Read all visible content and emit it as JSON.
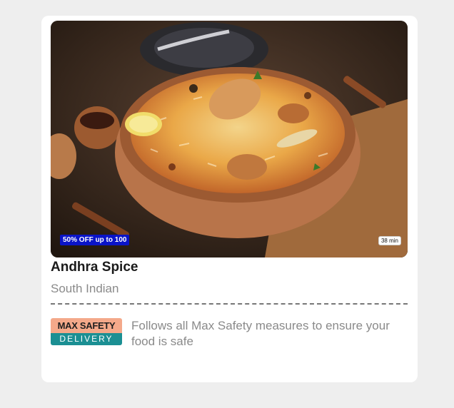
{
  "restaurant": {
    "name": "Andhra Spice",
    "cuisine": "South Indian",
    "offer": "50% OFF up to 100",
    "delivery_time": "38 min"
  },
  "safety": {
    "logo_top": "MAX SAFETY",
    "logo_bottom": "DELIVERY",
    "message": "Follows all Max Safety measures to ensure your food is safe"
  },
  "colors": {
    "offer_badge": "#0a14c8",
    "safety_peach": "#f4a98a",
    "safety_teal": "#1b8f93"
  },
  "image": {
    "subject": "biryani-dish-photo"
  }
}
